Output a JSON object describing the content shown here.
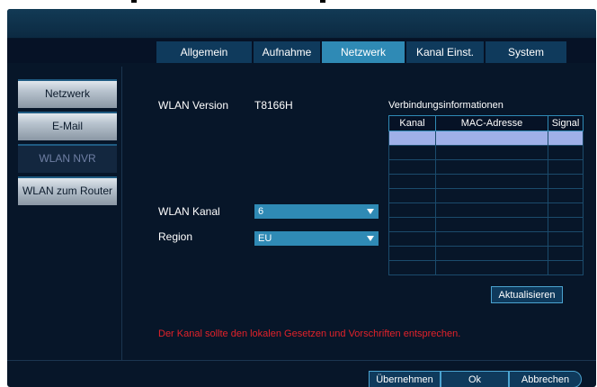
{
  "tabs": [
    {
      "label": "Allgemein"
    },
    {
      "label": "Aufnahme"
    },
    {
      "label": "Netzwerk"
    },
    {
      "label": "Kanal Einst."
    },
    {
      "label": "System"
    }
  ],
  "active_tab": "Netzwerk",
  "sidebar": {
    "items": [
      {
        "label": "Netzwerk"
      },
      {
        "label": "E-Mail"
      },
      {
        "label": "WLAN NVR"
      },
      {
        "label": "WLAN zum Router"
      }
    ],
    "active": "WLAN NVR"
  },
  "wlan": {
    "version_label": "WLAN Version",
    "version_value": "T8166H",
    "channel_label": "WLAN Kanal",
    "channel_value": "6",
    "region_label": "Region",
    "region_value": "EU"
  },
  "connection": {
    "title": "Verbindungsinformationen",
    "columns": [
      "Kanal",
      "MAC-Adresse",
      "Signal"
    ],
    "rows": [],
    "refresh_label": "Aktualisieren"
  },
  "warning": "Der Kanal sollte den lokalen Gesetzen und Vorschriften entsprechen.",
  "buttons": {
    "apply": "Übernehmen",
    "ok": "Ok",
    "cancel": "Abbrechen"
  },
  "colors": {
    "background": "#071629",
    "accent": "#2f8ab5",
    "warning": "#e2222a",
    "selected_row": "#9fb0e8"
  }
}
